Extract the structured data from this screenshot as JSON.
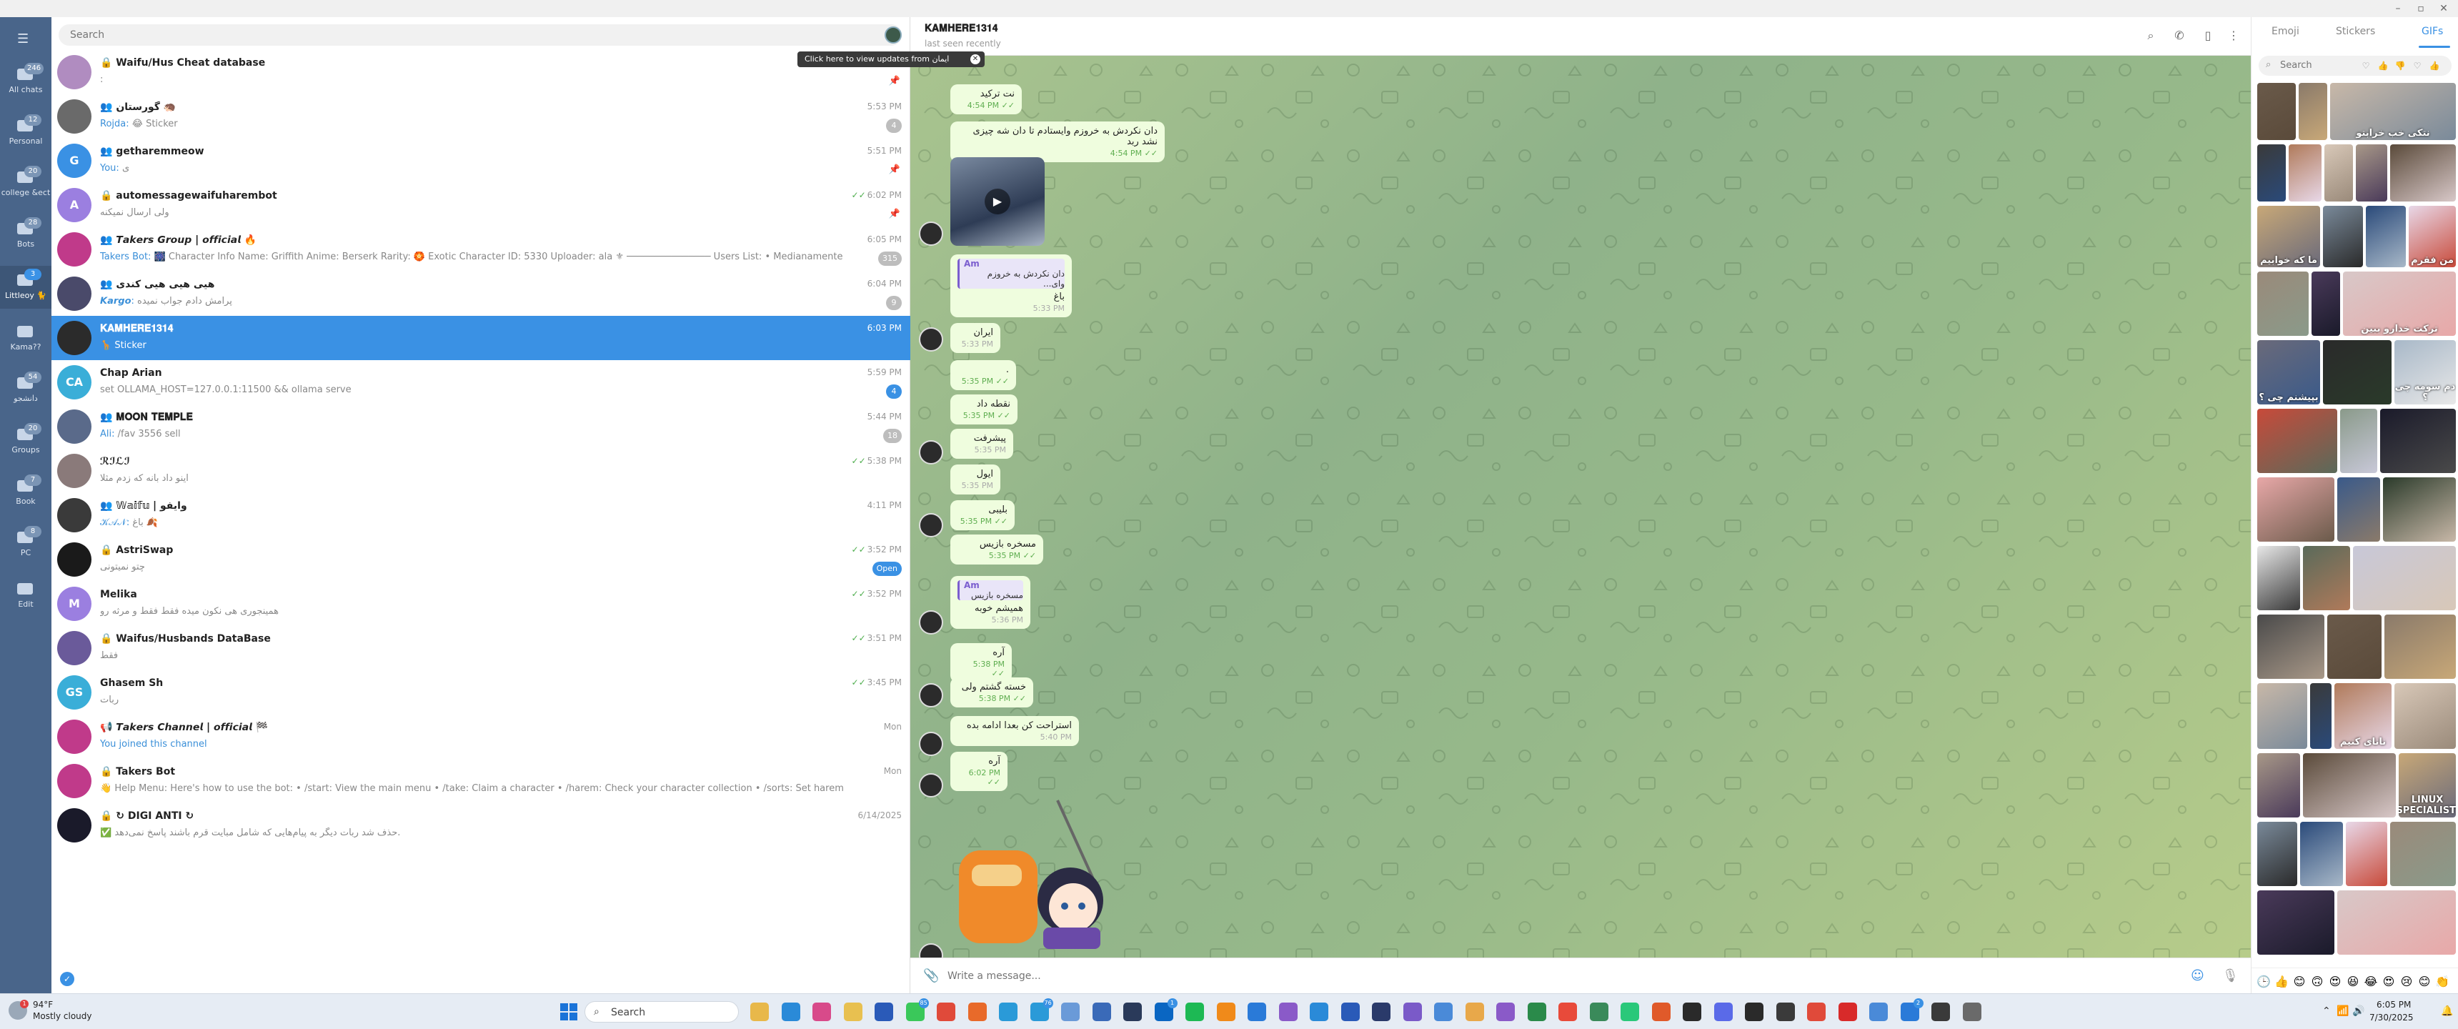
{
  "window": {
    "minimize": "–",
    "maximize": "▫",
    "close": "✕"
  },
  "folders": [
    {
      "label": "All chats",
      "badge": "246",
      "icon": "chat-bubble-icon"
    },
    {
      "label": "Personal",
      "badge": "12",
      "icon": "person-icon"
    },
    {
      "label": "college &ect",
      "badge": "20",
      "icon": "folder-icon"
    },
    {
      "label": "Bots",
      "badge": "28",
      "icon": "folder-icon"
    },
    {
      "label": "Littleoy 🐈",
      "badge": "3",
      "icon": "folder-icon",
      "active": true
    },
    {
      "label": "Kama??",
      "badge": "",
      "icon": "folder-icon"
    },
    {
      "label": "دانشجو",
      "badge": "54",
      "icon": "folder-icon"
    },
    {
      "label": "Groups",
      "badge": "20",
      "icon": "group-icon"
    },
    {
      "label": "Book",
      "badge": "7",
      "icon": "folder-icon"
    },
    {
      "label": "PC",
      "badge": "8",
      "icon": "folder-icon"
    },
    {
      "label": "Edit",
      "badge": "",
      "icon": "sliders-icon"
    }
  ],
  "search": {
    "placeholder": "Search"
  },
  "tooltip": {
    "text": "Click here to view updates from ایمان",
    "close": "✕"
  },
  "chats": [
    {
      "name": "🔒 Waifu/Hus Cheat database",
      "preview": ":",
      "sender": "",
      "time": "",
      "pinned": true,
      "avatar_color": "#b08cc0",
      "initials": ""
    },
    {
      "name": "👥 گورستان 🦔",
      "preview": "😂 Sticker",
      "sender": "Rojda:",
      "time": "5:53 PM",
      "count": "4",
      "pinned": false,
      "avatar_color": "#6a6a6a",
      "initials": ""
    },
    {
      "name": "👥 getharemmeow",
      "preview": "ی",
      "sender": "You:",
      "time": "5:51 PM",
      "pinned": true,
      "avatar_color": "#3a91e4",
      "initials": "G"
    },
    {
      "name": "🔒 automessagewaifuharembot",
      "preview": "ولی ارسال نمیکنه",
      "sender": "",
      "time": "6:02 PM",
      "check": "✓✓",
      "pinned": true,
      "avatar_color": "#9b7fe0",
      "initials": "A"
    },
    {
      "name": "👥 𝙏𝙖𝙠𝙚𝙧𝙨 𝙂𝙧𝙤𝙪𝙥 | 𝙤𝙛𝙛𝙞𝙘𝙞𝙖𝙡 🔥",
      "preview": "🎆 Character Info  Name: Griffith Anime: Berserk Rarity: 🏵️ Exotic Character ID: 5330 Uploader: ala ⚜  ─────────────── Users List: • Medianamente Wholesome$EXT • Hel...",
      "sender": "Takers Bot:",
      "time": "6:05 PM",
      "count": "315",
      "pinned": false,
      "avatar_color": "#c03a8a",
      "initials": ""
    },
    {
      "name": "👥 هیی هیی هیی کندی",
      "preview": "پرامش دادم جواب نمیده",
      "sender": "𝙆𝙖𝙧𝙜𝙤:",
      "time": "6:04 PM",
      "count": "9",
      "pinned": false,
      "avatar_color": "#4a4a6a",
      "initials": ""
    },
    {
      "name": "𝐊𝐀𝐌𝐇𝐄𝐑𝐄𝟏𝟑𝟏𝟒",
      "preview": "🦒 Sticker",
      "sender": "",
      "time": "6:03 PM",
      "pinned": false,
      "selected": true,
      "avatar_color": "#2b2b2b",
      "initials": ""
    },
    {
      "name": "Chap Arian",
      "preview": "set OLLAMA_HOST=127.0.0.1:11500 && ollama serve",
      "sender": "",
      "time": "5:59 PM",
      "count": "4",
      "count_blue": true,
      "pinned": false,
      "avatar_color": "#3aaed8",
      "initials": "CA"
    },
    {
      "name": "👥 𝐌𝐎𝐎𝐍 𝐓𝐄𝐌𝐏𝐋𝐄",
      "preview": "/fav 3556 sell",
      "sender": "Ali:",
      "time": "5:44 PM",
      "count": "18",
      "pinned": false,
      "avatar_color": "#5a6a8a",
      "initials": ""
    },
    {
      "name": "ℛℐℒℐ",
      "preview": "اینو داد بانه که زدم مثلا",
      "sender": "",
      "time": "5:38 PM",
      "check": "✓✓",
      "pinned": false,
      "avatar_color": "#8a7a7a",
      "initials": ""
    },
    {
      "name": "👥 𝕎𝕒𝕚𝕗𝕦 | وایفو",
      "preview": "باغ 🍂",
      "sender": "𝒦𝒜𝒩:",
      "time": "4:11 PM",
      "pinned": false,
      "avatar_color": "#3a3a3a",
      "initials": ""
    },
    {
      "name": "🔒 AstriSwap",
      "preview": "چتو نمیتونی",
      "sender": "",
      "time": "3:52 PM",
      "check": "✓✓",
      "open": "Open",
      "pinned": false,
      "avatar_color": "#1a1a1a",
      "initials": ""
    },
    {
      "name": "Melika",
      "preview": "همینجوری هی نکون میده فقط فقط و مرثه رو",
      "sender": "",
      "time": "3:52 PM",
      "check": "✓✓",
      "pinned": false,
      "avatar_color": "#9b7fe0",
      "initials": "M"
    },
    {
      "name": "🔒 Waifus/Husbands DataBase",
      "preview": "فقط",
      "sender": "",
      "time": "3:51 PM",
      "check": "✓✓",
      "pinned": false,
      "avatar_color": "#6a5a9a",
      "initials": ""
    },
    {
      "name": "Ghasem Sh",
      "preview": "ربات",
      "sender": "",
      "time": "3:45 PM",
      "check": "✓✓",
      "pinned": false,
      "avatar_color": "#3aaed8",
      "initials": "GS"
    },
    {
      "name": "📢 𝙏𝙖𝙠𝙚𝙧𝙨 𝘾𝙝𝙖𝙣𝙣𝙚𝙡 | 𝙤𝙛𝙛𝙞𝙘𝙞𝙖𝙡 🏁",
      "preview": "You joined this channel",
      "sender": "",
      "time": "Mon",
      "preview_blue": true,
      "pinned": false,
      "avatar_color": "#c03a8a",
      "initials": ""
    },
    {
      "name": "🔒 Takers Bot",
      "preview": "👋 Help Menu: Here's how to use the bot: • /start: View the main menu • /take: Claim a character • /harem: Check your character collection • /sorts: Set harem sorting options • /gift: Gift a character to som...",
      "sender": "",
      "time": "Mon",
      "pinned": false,
      "avatar_color": "#c03a8a",
      "initials": ""
    },
    {
      "name": "🔒 ↻ DIGI ANTI ↻",
      "preview": "✅ حذف شد ربات دیگر به پیام‌هایی که شامل مبایت  قرم  باشند پاسخ نمی‌دهد.",
      "sender": "",
      "time": "6/14/2025",
      "pinned": false,
      "avatar_color": "#1a1a2a",
      "initials": ""
    }
  ],
  "chat": {
    "title": "𝐊𝐀𝐌𝐇𝐄𝐑𝐄𝟏𝟑𝟏𝟒",
    "status": "last seen recently",
    "messages": [
      {
        "text": "نت ترکید",
        "time": "4:54 PM",
        "status": "✓✓"
      },
      {
        "text": "دان نکردش به خروزم وایستادم تا دان شه چیزی نشد ربد",
        "time": "4:54 PM",
        "status": "✓✓"
      },
      {
        "reply_name": "Am",
        "reply_text": "دان نکردش به خروزم وای...",
        "text": "باغ",
        "time": "5:33 PM"
      },
      {
        "text": "ایران",
        "time": "5:33 PM"
      },
      {
        "text": ".",
        "time": "5:35 PM",
        "status": "✓✓"
      },
      {
        "text": "نقطه داد",
        "time": "5:35 PM",
        "status": "✓✓"
      },
      {
        "text": "پیشرفت",
        "time": "5:35 PM"
      },
      {
        "text": "ایول",
        "time": "5:35 PM"
      },
      {
        "text": "بلیبی",
        "time": "5:35 PM",
        "status": "✓✓"
      },
      {
        "text": "مسخره بازیس",
        "time": "5:35 PM",
        "status": "✓✓"
      },
      {
        "reply_name": "Am",
        "reply_text": "مسخره بازیس",
        "text": "همیشم خوبه",
        "time": "5:36 PM"
      },
      {
        "text": "آره",
        "time": "5:38 PM",
        "status": "✓✓"
      },
      {
        "text": "خسته گشتم ولی",
        "time": "5:38 PM",
        "status": "✓✓"
      },
      {
        "text": "استراحت کن بعدا ادامه بده",
        "time": "5:40 PM"
      },
      {
        "text": "آره",
        "time": "6:02 PM",
        "status": "✓✓"
      }
    ],
    "input_placeholder": "Write a message..."
  },
  "panel": {
    "tabs": [
      "Emoji",
      "Stickers",
      "GIFs"
    ],
    "active_tab": "GIFs",
    "search_placeholder": "Search",
    "gif_captions": [
      "نتکی خب خرابتو",
      "ما که خوابیم",
      "من فقرم",
      "ترکت خدارو ببین",
      "بپیشنم چی ؟",
      "دم سومه چی ؟",
      "نانای کنیم",
      "LINUX SPECIALIST"
    ],
    "emoji_row": [
      "🕒",
      "👍",
      "😊",
      "🙃",
      "😍",
      "😆",
      "😂",
      "😍",
      "😢",
      "😊",
      "👏"
    ]
  },
  "taskbar": {
    "weather_temp": "94°F",
    "weather_desc": "Mostly cloudy",
    "weather_badge": "1",
    "search_label": "Search",
    "time": "6:05 PM",
    "date": "7/30/2025",
    "badges": {
      "whatsapp": "85",
      "telegram": "76",
      "linkedin": "1",
      "extra": "2"
    }
  }
}
